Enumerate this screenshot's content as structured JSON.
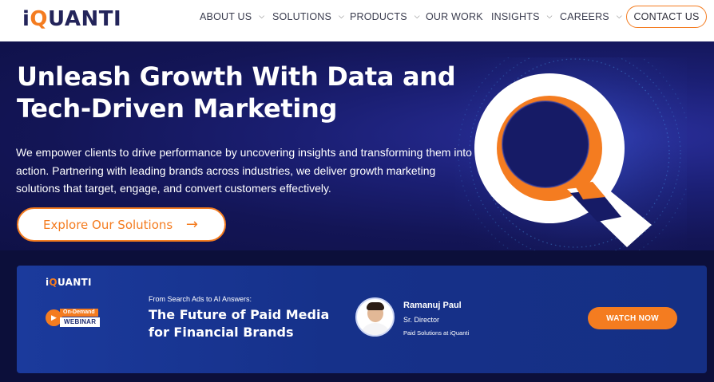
{
  "nav": {
    "logo": {
      "prefix": "i",
      "accent": "Q",
      "rest": "UANTI"
    },
    "items": [
      {
        "label": "ABOUT US",
        "has_dropdown": true
      },
      {
        "label": "SOLUTIONS",
        "has_dropdown": true
      },
      {
        "label": "PRODUCTS",
        "has_dropdown": true
      },
      {
        "label": "OUR WORK",
        "has_dropdown": false
      },
      {
        "label": "INSIGHTS",
        "has_dropdown": true
      },
      {
        "label": "CAREERS",
        "has_dropdown": true
      }
    ],
    "contact_label": "CONTACT US"
  },
  "hero": {
    "title": "Unleash Growth With Data and Tech-Driven Marketing",
    "body": "We empower clients to drive performance by uncovering insights and transforming them into action. Partnering with leading brands across industries, we deliver growth marketing solutions that target, engage, and convert customers effectively.",
    "cta_label": "Explore Our Solutions",
    "cta_arrow": "→"
  },
  "banner": {
    "logo": {
      "prefix": "i",
      "accent": "Q",
      "rest": "UANTI"
    },
    "badge_top": "On-Demand",
    "badge_bottom": "WEBINAR",
    "kicker": "From Search Ads to AI Answers:",
    "title": "The Future of Paid Media for Financial Brands",
    "speaker_name": "Ramanuj Paul",
    "speaker_role": "Sr. Director",
    "speaker_org": "Paid Solutions at iQuanti",
    "watch_label": "WATCH NOW"
  },
  "colors": {
    "accent": "#f47c20",
    "navy": "#23245a",
    "hero_bg": "#131556",
    "banner_bg": "#16318a"
  },
  "icons": {
    "dropdown": "chevron-down-icon",
    "arrow": "arrow-right-icon",
    "play": "play-icon"
  }
}
